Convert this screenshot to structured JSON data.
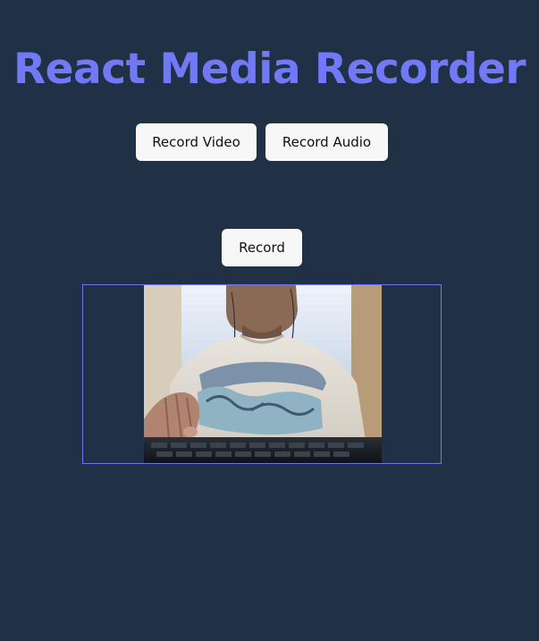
{
  "header": {
    "title": "React Media Recorder"
  },
  "mode_buttons": {
    "record_video_label": "Record Video",
    "record_audio_label": "Record Audio"
  },
  "controls": {
    "record_label": "Record"
  },
  "colors": {
    "background": "#213145",
    "accent": "#7179f7",
    "button_bg": "#f7f7f7",
    "frame_border": "#6f77f0"
  },
  "preview": {
    "icon": "webcam-preview"
  }
}
